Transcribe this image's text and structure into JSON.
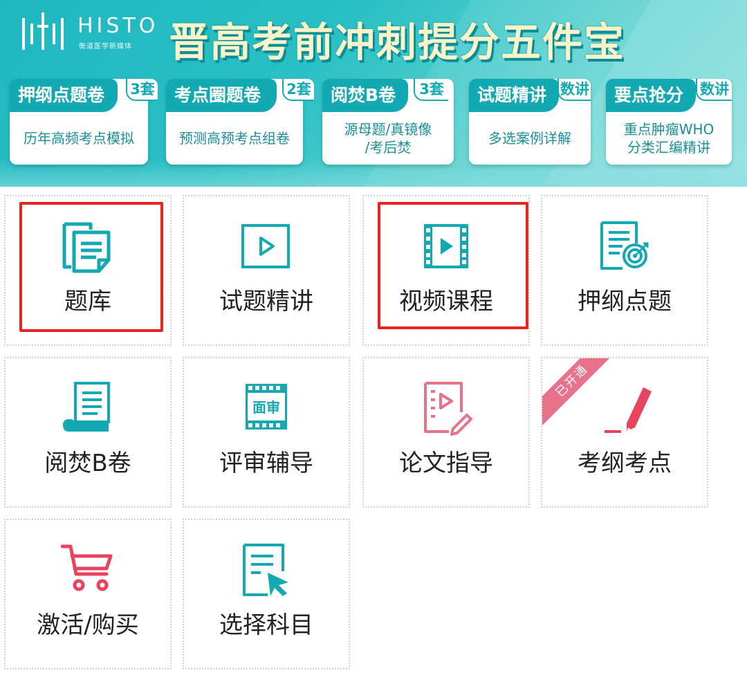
{
  "banner": {
    "logo_text": "HISTO",
    "logo_sub": "衡道医学新媒体",
    "title": "晋高考前冲刺提分五件宝",
    "cards": [
      {
        "tab": "押纲点题卷",
        "badge": "3套",
        "desc": "历年高频考点模拟"
      },
      {
        "tab": "考点圈题卷",
        "badge": "2套",
        "desc": "预测高预考点组卷"
      },
      {
        "tab": "阅焚B卷",
        "badge": "3套",
        "desc": "源母题/真镜像\n/考后焚"
      },
      {
        "tab": "试题精讲",
        "badge": "数讲",
        "desc": "多选案例详解"
      },
      {
        "tab": "要点抢分",
        "badge": "数讲",
        "desc": "重点肿瘤WHO\n分类汇编精讲"
      }
    ]
  },
  "grid": {
    "items": [
      {
        "label": "题库",
        "icon": "document-stack-icon",
        "highlighted": true
      },
      {
        "label": "试题精讲",
        "icon": "play-icon",
        "highlighted": false
      },
      {
        "label": "视频课程",
        "icon": "film-icon",
        "highlighted": true
      },
      {
        "label": "押纲点题",
        "icon": "doc-target-icon",
        "highlighted": false
      },
      {
        "label": "阅焚B卷",
        "icon": "scroll-icon",
        "highlighted": false
      },
      {
        "label": "评审辅导",
        "icon": "film-review-icon",
        "icon_text": "面审",
        "highlighted": false
      },
      {
        "label": "论文指导",
        "icon": "paper-video-icon",
        "highlighted": false
      },
      {
        "label": "考纲考点",
        "icon": "pencil-icon",
        "ribbon": "已开通",
        "highlighted": false
      },
      {
        "label": "激活/购买",
        "icon": "cart-icon",
        "highlighted": false
      },
      {
        "label": "选择科目",
        "icon": "select-subject-icon",
        "highlighted": false
      }
    ]
  },
  "colors": {
    "teal": "#13a9b2",
    "pink": "#e8445f",
    "highlight_red": "#e6251e"
  }
}
